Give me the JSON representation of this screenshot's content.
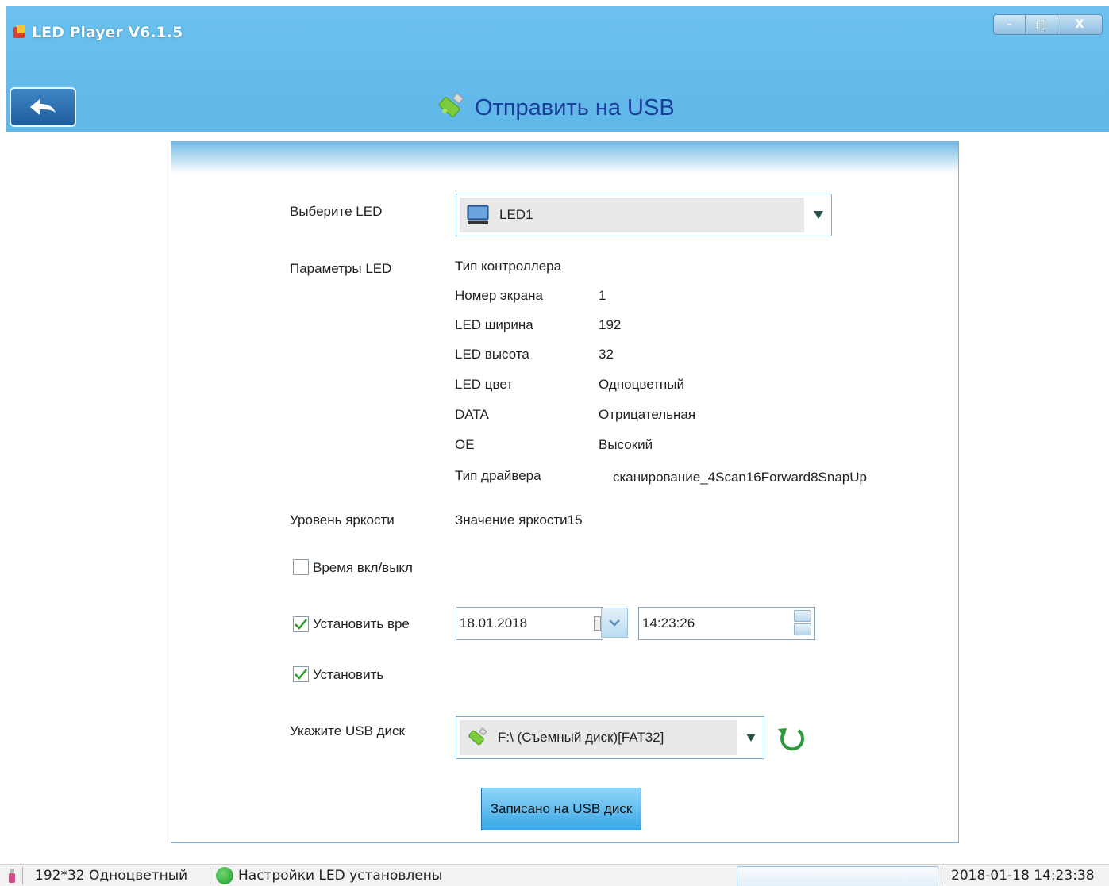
{
  "window": {
    "title": "LED Player V6.1.5",
    "minimize_glyph": "–",
    "maximize_glyph": "□",
    "close_glyph": "X"
  },
  "header": {
    "heading": "Отправить на USB"
  },
  "form": {
    "select_led_label": "Выберите LED",
    "select_led_value": "LED1",
    "params_label": "Параметры LED",
    "params": [
      {
        "name": "Тип контроллера",
        "value": ""
      },
      {
        "name": "Номер экрана",
        "value": "1"
      },
      {
        "name": "LED ширина",
        "value": "192"
      },
      {
        "name": "LED высота",
        "value": "32"
      },
      {
        "name": "LED цвет",
        "value": "Одноцветный"
      },
      {
        "name": "DATA",
        "value": "Отрицательная"
      },
      {
        "name": "OE",
        "value": "Высокий"
      },
      {
        "name": "Тип драйвера",
        "value": "сканирование_4Scan16Forward8SnapUp"
      }
    ],
    "brightness_label": "Уровень яркости",
    "brightness_value": "Значение яркости15",
    "onoff_time_label": "Время вкл/выкл",
    "onoff_time_checked": false,
    "set_time_label": "Установить вре",
    "set_time_checked": true,
    "date_value": "18.01.2018",
    "time_value": "14:23:26",
    "set_label": "Установить",
    "set_checked": true,
    "usb_label": "Укажите USB диск",
    "usb_value": "F:\\ (Съемный диск)[FAT32]",
    "write_button": "Записано на USB диск"
  },
  "statusbar": {
    "screen_info": "192*32 Одноцветный",
    "status_text": "Настройки LED установлены",
    "datetime": "2018-01-18 14:23:38"
  },
  "colors": {
    "header_blue": "#6cc1ee",
    "heading_text": "#1c3d99",
    "button_blue": "#39a7e6",
    "status_green": "#1f9a2f"
  }
}
